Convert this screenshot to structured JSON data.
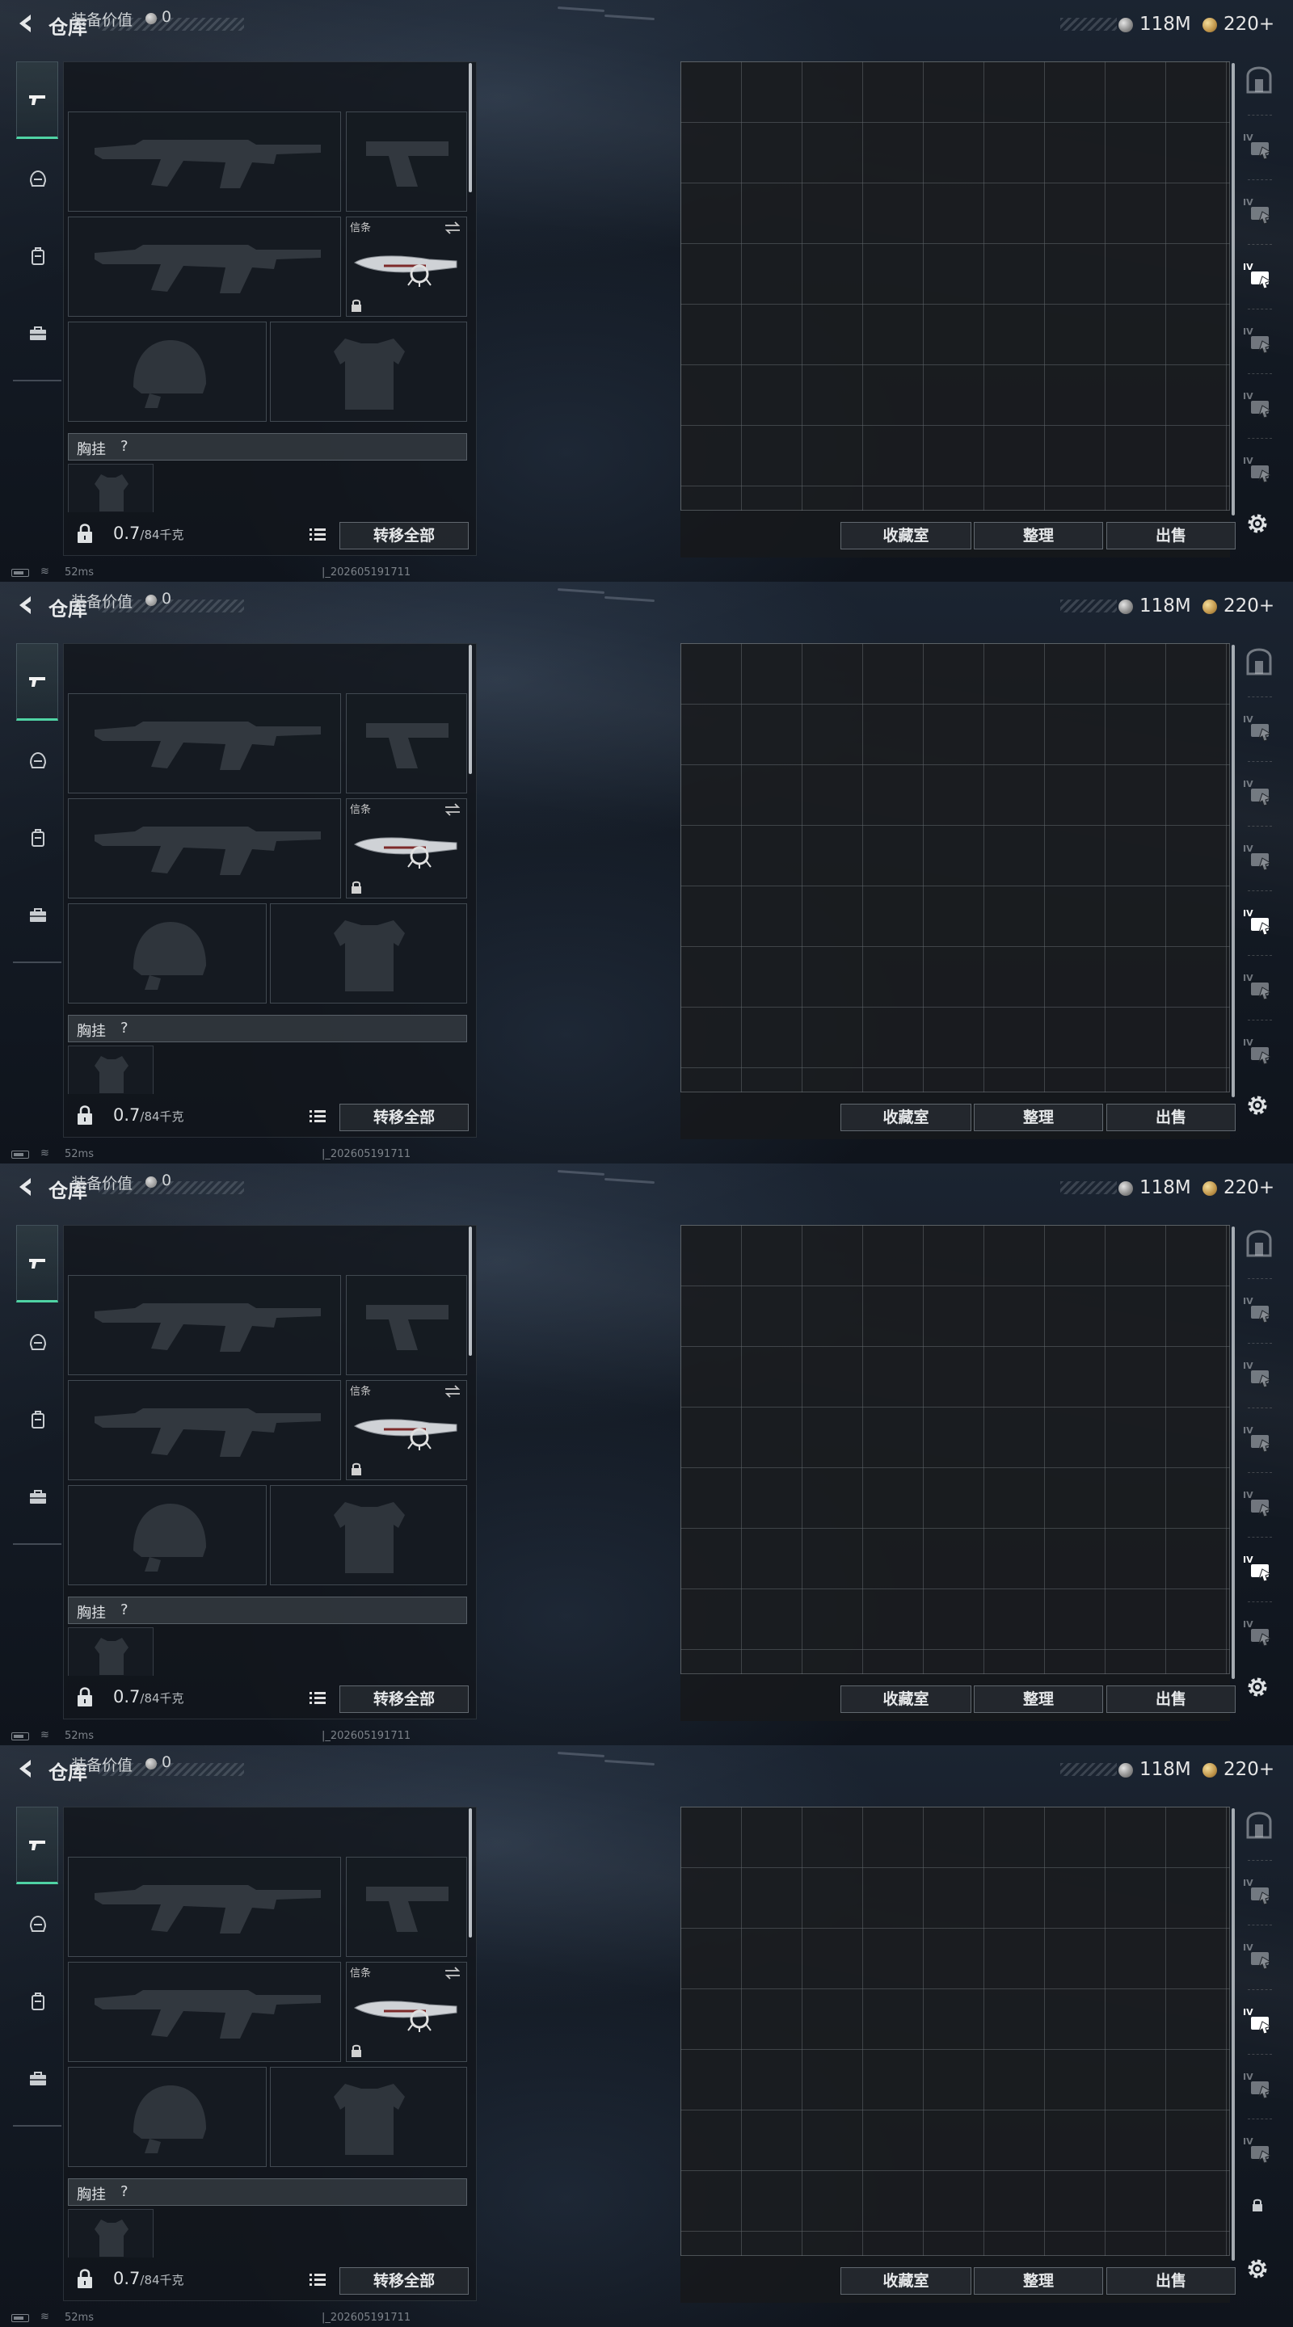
{
  "header": {
    "title": "仓库",
    "currency_silver": "118M",
    "currency_gold": "220+"
  },
  "equipment": {
    "value_label": "装备价值",
    "value": "0",
    "knife_label": "信条"
  },
  "vest": {
    "label": "胸挂",
    "hint": "?"
  },
  "weight": {
    "current": "0.7",
    "capacity": "/84千克"
  },
  "buttons": {
    "transfer_all": "转移全部",
    "collection": "收藏室",
    "organize": "整理",
    "sell": "出售"
  },
  "status": {
    "ping": "52ms",
    "session_id": "|_202605191711"
  },
  "frames": [
    {
      "active_page": 3,
      "page_locked": false
    },
    {
      "active_page": 4,
      "page_locked": false
    },
    {
      "active_page": 5,
      "page_locked": false
    },
    {
      "active_page": 3,
      "page_locked": true
    }
  ],
  "page_icons": [
    "safe-icon",
    "stash-page-icon",
    "stash-page-icon",
    "stash-page-icon",
    "stash-page-icon",
    "stash-page-icon",
    "stash-page-icon"
  ],
  "colors": {
    "accent": "#4fd3a4",
    "panel": "#12161c",
    "grid_line": "#5f646a"
  }
}
